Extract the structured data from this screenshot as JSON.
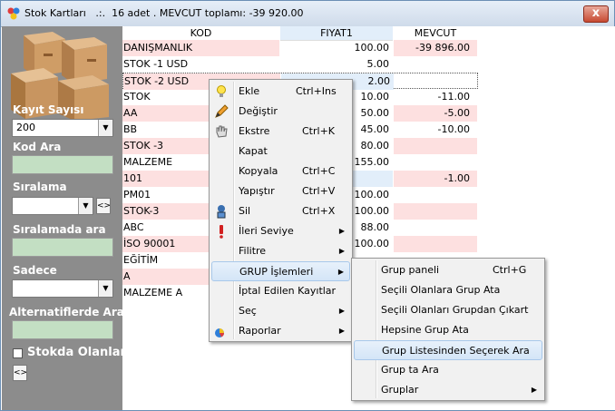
{
  "window": {
    "title": "Stok Kartları",
    "summary": ".:.  16 adet . MEVCUT toplamı: -39 920.00",
    "close_label": "x"
  },
  "sidebar": {
    "kayit_sayisi_label": "Kayıt Sayısı",
    "kayit_sayisi_value": "200",
    "kod_ara_label": "Kod Ara",
    "siralama_label": "Sıralama",
    "siralamada_ara_label": "Sıralamada ara",
    "sadece_label": "Sadece",
    "alternatif_label": "Alternatiflerde Ara",
    "stokda_olanlar_label": "Stokda Olanlar",
    "swap_button_label": "<>"
  },
  "grid": {
    "columns": [
      "KOD",
      "FIYAT1",
      "MEVCUT"
    ],
    "rows": [
      {
        "kod": "DANIŞMANLIK",
        "fiyat": "100.00",
        "mevcut": "-39 896.00"
      },
      {
        "kod": "STOK -1 USD",
        "fiyat": "5.00",
        "mevcut": ""
      },
      {
        "kod": "STOK -2 USD",
        "fiyat": "2.00",
        "mevcut": ""
      },
      {
        "kod": "STOK",
        "fiyat": "10.00",
        "mevcut": "-11.00"
      },
      {
        "kod": "AA",
        "fiyat": "50.00",
        "mevcut": "-5.00"
      },
      {
        "kod": "BB",
        "fiyat": "45.00",
        "mevcut": "-10.00"
      },
      {
        "kod": "STOK -3",
        "fiyat": "80.00",
        "mevcut": ""
      },
      {
        "kod": "MALZEME",
        "fiyat": "155.00",
        "mevcut": ""
      },
      {
        "kod": "101",
        "fiyat": "",
        "mevcut": "-1.00"
      },
      {
        "kod": "PM01",
        "fiyat": "100.00",
        "mevcut": ""
      },
      {
        "kod": "STOK-3",
        "fiyat": "100.00",
        "mevcut": ""
      },
      {
        "kod": "ABC",
        "fiyat": "88.00",
        "mevcut": ""
      },
      {
        "kod": "İSO 90001",
        "fiyat": "100.00",
        "mevcut": ""
      },
      {
        "kod": "EĞİTİM",
        "fiyat": "",
        "mevcut": ""
      },
      {
        "kod": "A",
        "fiyat": "",
        "mevcut": ""
      },
      {
        "kod": "MALZEME A",
        "fiyat": "",
        "mevcut": ""
      }
    ]
  },
  "context_menu": {
    "items": [
      {
        "label": "Ekle",
        "shortcut": "Ctrl+Ins",
        "icon": "bulb-icon"
      },
      {
        "label": "Değiştir",
        "shortcut": "",
        "icon": "pencil-icon"
      },
      {
        "label": "Ekstre",
        "shortcut": "Ctrl+K",
        "icon": "hand-icon"
      },
      {
        "label": "Kapat",
        "shortcut": "",
        "icon": ""
      },
      {
        "label": "Kopyala",
        "shortcut": "Ctrl+C",
        "icon": ""
      },
      {
        "label": "Yapıştır",
        "shortcut": "Ctrl+V",
        "icon": ""
      },
      {
        "label": "Sil",
        "shortcut": "Ctrl+X",
        "icon": "delete-icon"
      },
      {
        "label": "İleri Seviye",
        "shortcut": "",
        "icon": "exclamation-icon",
        "submenu": true
      },
      {
        "label": "Filitre",
        "shortcut": "",
        "icon": "",
        "submenu": true
      },
      {
        "label": "GRUP İşlemleri",
        "shortcut": "",
        "icon": "",
        "submenu": true,
        "highlighted": true
      },
      {
        "label": "İptal Edilen Kayıtlar",
        "shortcut": "",
        "icon": ""
      },
      {
        "label": "Seç",
        "shortcut": "",
        "icon": "",
        "submenu": true
      },
      {
        "label": "Raporlar",
        "shortcut": "",
        "icon": "report-icon",
        "submenu": true
      }
    ]
  },
  "group_submenu": {
    "items": [
      {
        "label": "Grup paneli",
        "shortcut": "Ctrl+G"
      },
      {
        "label": "Seçili Olanlara Grup Ata",
        "shortcut": ""
      },
      {
        "label": "Seçili Olanları Grupdan Çıkart",
        "shortcut": ""
      },
      {
        "label": "Hepsine Grup Ata",
        "shortcut": ""
      },
      {
        "label": "Grup Listesinden Seçerek Ara",
        "shortcut": "",
        "highlighted": true
      },
      {
        "label": "Grup ta Ara",
        "shortcut": ""
      },
      {
        "label": "Gruplar",
        "shortcut": "",
        "submenu": true
      }
    ]
  },
  "colors": {
    "sidebar_bg": "#8c8c8c",
    "green_field": "#c3dfc3",
    "pink_row": "#fde0e0",
    "blue_cell": "#e2eefa",
    "close_red": "#c74a32"
  }
}
